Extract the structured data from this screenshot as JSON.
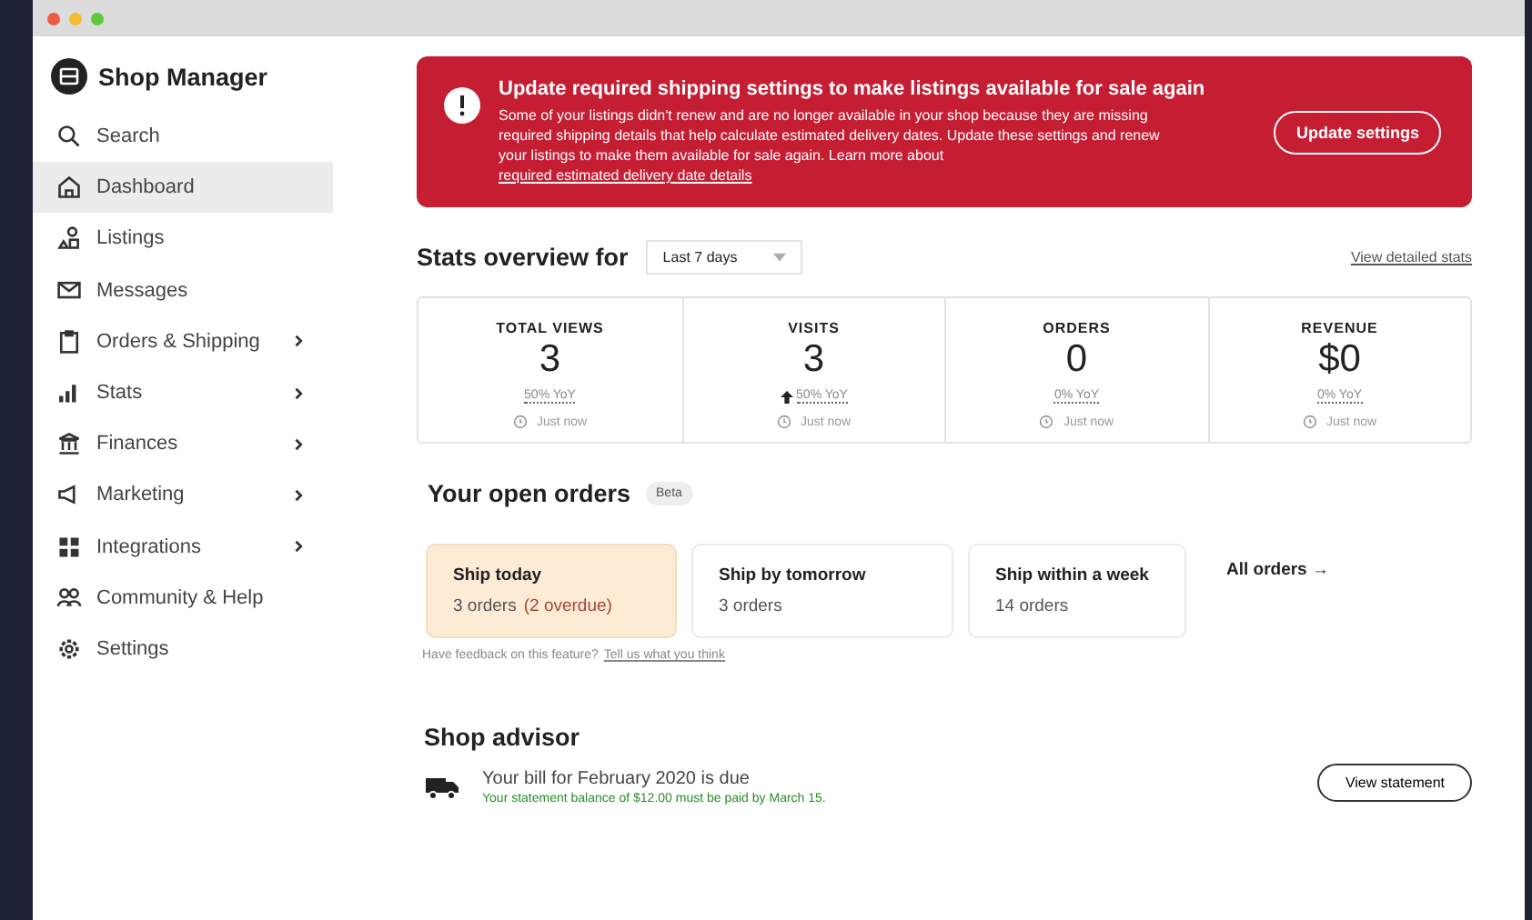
{
  "sidebar": {
    "title": "Shop Manager",
    "items": [
      {
        "label": "Search",
        "selected": false,
        "has_submenu": false
      },
      {
        "label": "Dashboard",
        "selected": true,
        "has_submenu": false
      },
      {
        "label": "Listings",
        "selected": false,
        "has_submenu": false
      },
      {
        "label": "Messages",
        "selected": false,
        "has_submenu": false
      },
      {
        "label": "Orders & Shipping",
        "selected": false,
        "has_submenu": true
      },
      {
        "label": "Stats",
        "selected": false,
        "has_submenu": true
      },
      {
        "label": "Finances",
        "selected": false,
        "has_submenu": true
      },
      {
        "label": "Marketing",
        "selected": false,
        "has_submenu": true
      },
      {
        "label": "Integrations",
        "selected": false,
        "has_submenu": true
      },
      {
        "label": "Community & Help",
        "selected": false,
        "has_submenu": false
      },
      {
        "label": "Settings",
        "selected": false,
        "has_submenu": false
      }
    ]
  },
  "alert": {
    "title": "Update required shipping settings to make listings available for sale again",
    "body": "Some of your listings didn't renew and are no longer available in your shop because they are missing required shipping details that help calculate estimated delivery dates. Update these settings and renew your listings to make them available for sale again. Learn more about",
    "link": "required estimated delivery date details",
    "button": "Update settings"
  },
  "stats": {
    "title": "Stats overview for",
    "period": "Last 7 days",
    "link": "View detailed stats",
    "cards": [
      {
        "label": "TOTAL VIEWS",
        "value": "3",
        "change": "50% YoY",
        "rising": false,
        "updated": "Just now"
      },
      {
        "label": "VISITS",
        "value": "3",
        "change": "50% YoY",
        "rising": true,
        "updated": "Just now"
      },
      {
        "label": "ORDERS",
        "value": "0",
        "change": "0% YoY",
        "rising": false,
        "updated": "Just now"
      },
      {
        "label": "REVENUE",
        "value": "$0",
        "change": "0% YoY",
        "rising": false,
        "updated": "Just now"
      }
    ]
  },
  "orders": {
    "title": "Your open orders",
    "badge": "Beta",
    "cards": [
      {
        "title": "Ship today",
        "count": "3 orders",
        "overdue": "(2 overdue)",
        "urgent": true
      },
      {
        "title": "Ship by tomorrow",
        "count": "3 orders",
        "urgent": false
      },
      {
        "title": "Ship within a week",
        "count": "14 orders",
        "urgent": false
      }
    ],
    "all_link": "All orders →",
    "feedback": "Have feedback on this feature?",
    "feedback_link": "Tell us what you think"
  },
  "advisor": {
    "title": "Shop advisor",
    "item_title": "Your bill for February 2020 is due",
    "item_body": "Your statement balance of $12.00 must be paid by March 15.",
    "button": "View statement"
  }
}
